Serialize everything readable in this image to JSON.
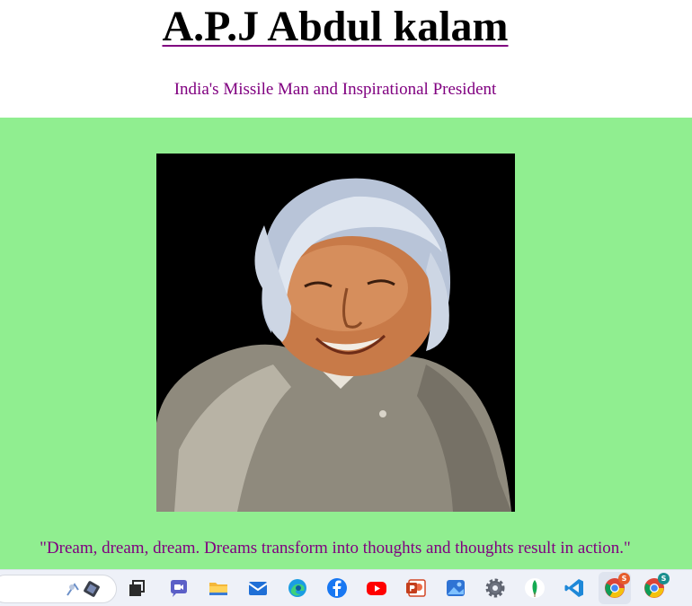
{
  "header": {
    "title": "A.P.J Abdul kalam",
    "subtitle": "India's Missile Man and Inspirational President"
  },
  "main": {
    "background": "#90ee90",
    "portrait": {
      "icon": "kalam-portrait-image"
    },
    "quote": "\"Dream, dream, dream. Dreams transform into thoughts and thoughts result in action.\""
  },
  "colors": {
    "title": "#000000",
    "accent": "#800080",
    "main_bg": "#90ee90"
  },
  "taskbar": {
    "search_decoration": "search-highlight-image",
    "apps": [
      {
        "name": "task-view-icon"
      },
      {
        "name": "teams-chat-icon"
      },
      {
        "name": "file-explorer-icon"
      },
      {
        "name": "mail-icon"
      },
      {
        "name": "edge-browser-icon"
      },
      {
        "name": "facebook-icon"
      },
      {
        "name": "youtube-icon"
      },
      {
        "name": "powerpoint-icon"
      },
      {
        "name": "photos-icon"
      },
      {
        "name": "settings-icon"
      },
      {
        "name": "mongodb-icon"
      },
      {
        "name": "vscode-icon"
      },
      {
        "name": "chrome-profile-icon",
        "badge": "S"
      },
      {
        "name": "chrome-profile-2-icon",
        "badge": "S"
      }
    ]
  }
}
